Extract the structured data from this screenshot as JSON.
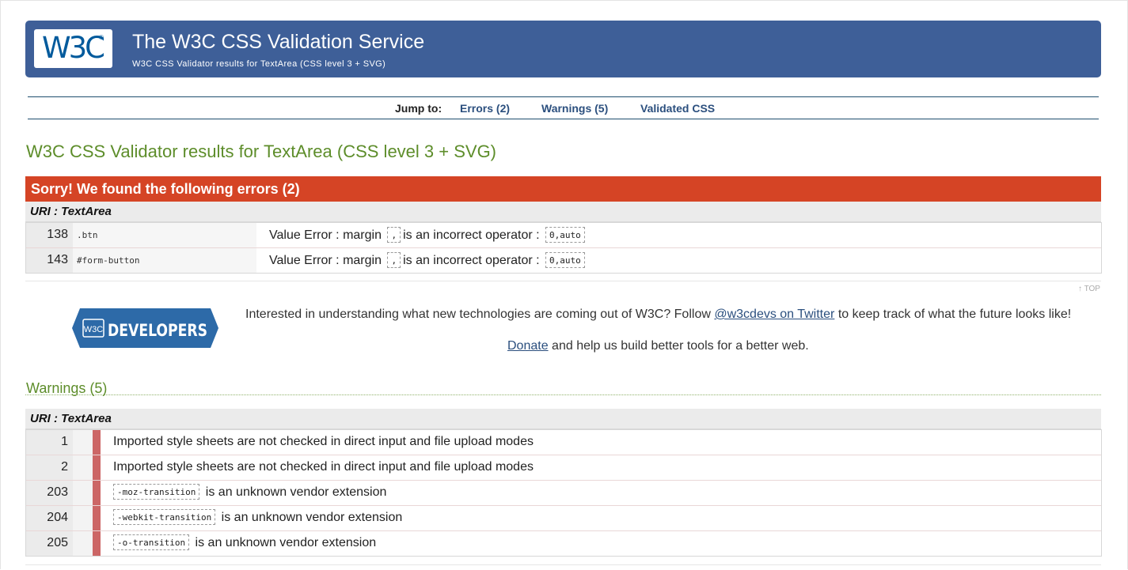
{
  "header": {
    "logo_text": "W3C",
    "logo_reg": "®",
    "title": "The W3C CSS Validation Service",
    "subtitle": "W3C CSS Validator results for TextArea (CSS level 3 + SVG)"
  },
  "jump": {
    "label": "Jump to:",
    "links": [
      "Errors (2)",
      "Warnings (5)",
      "Validated CSS"
    ]
  },
  "results_title": "W3C CSS Validator results for TextArea (CSS level 3 + SVG)",
  "errors": {
    "header": "Sorry! We found the following errors (2)",
    "uri": "URI : TextArea",
    "rows": [
      {
        "line": "138",
        "context": ".btn",
        "msg_pre": "Value Error : margin",
        "code1": ",",
        "msg_mid": "is an incorrect operator :",
        "code2": "0,auto"
      },
      {
        "line": "143",
        "context": "#form-button",
        "msg_pre": "Value Error : margin",
        "code1": ",",
        "msg_mid": "is an incorrect operator :",
        "code2": "0,auto"
      }
    ]
  },
  "top_link": "↑ TOP",
  "promo": {
    "logo_w3c": "W3C",
    "logo_word": "DEVELOPERS",
    "line1_pre": "Interested in understanding what new technologies are coming out of W3C? Follow",
    "line1_link": "@w3cdevs on Twitter",
    "line1_post": "to keep track of what the future looks like!",
    "line2_link": "Donate",
    "line2_post": "and help us build better tools for a better web."
  },
  "warnings": {
    "title": "Warnings (5)",
    "uri": "URI : TextArea",
    "rows": [
      {
        "line": "1",
        "code": "",
        "text": "Imported style sheets are not checked in direct input and file upload modes"
      },
      {
        "line": "2",
        "code": "",
        "text": "Imported style sheets are not checked in direct input and file upload modes"
      },
      {
        "line": "203",
        "code": "-moz-transition",
        "text": "is an unknown vendor extension"
      },
      {
        "line": "204",
        "code": "-webkit-transition",
        "text": "is an unknown vendor extension"
      },
      {
        "line": "205",
        "code": "-o-transition",
        "text": "is an unknown vendor extension"
      }
    ]
  },
  "colors": {
    "banner": "#3e5f98",
    "error_header": "#d54425",
    "title_green": "#5d8d2a",
    "link_blue": "#2b4f7e",
    "warning_bar": "#cc6666"
  }
}
